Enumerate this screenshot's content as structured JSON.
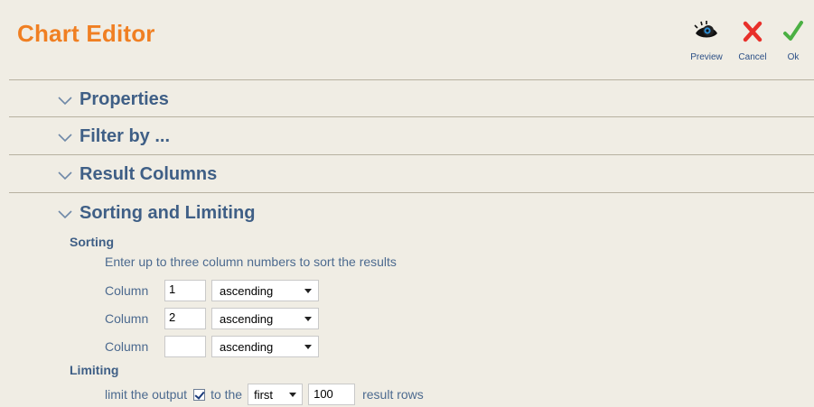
{
  "header": {
    "title": "Chart Editor",
    "title_color": "#f07f22",
    "actions": [
      {
        "label": "Preview",
        "icon": "eye-icon"
      },
      {
        "label": "Cancel",
        "icon": "close-icon",
        "color": "#e8302a"
      },
      {
        "label": "Ok",
        "icon": "checkmark-icon",
        "color": "#4bb043"
      }
    ]
  },
  "sections": [
    {
      "label": "Properties",
      "icon": "chevron-down-icon"
    },
    {
      "label": "Filter by ...",
      "icon": "chevron-down-icon"
    },
    {
      "label": "Result Columns",
      "icon": "chevron-down-icon"
    },
    {
      "label": "Sorting and Limiting",
      "icon": "chevron-down-icon"
    }
  ],
  "sorting": {
    "heading": "Sorting",
    "help": "Enter up to three column numbers to sort the results",
    "rows": [
      {
        "label": "Column",
        "value": "1",
        "order": "ascending"
      },
      {
        "label": "Column",
        "value": "2",
        "order": "ascending"
      },
      {
        "label": "Column",
        "value": "",
        "order": "ascending"
      }
    ]
  },
  "limiting": {
    "heading": "Limiting",
    "prefix": "limit the output",
    "checked": true,
    "middle": "to the",
    "mode": "first",
    "count": "100",
    "suffix": "result rows"
  }
}
